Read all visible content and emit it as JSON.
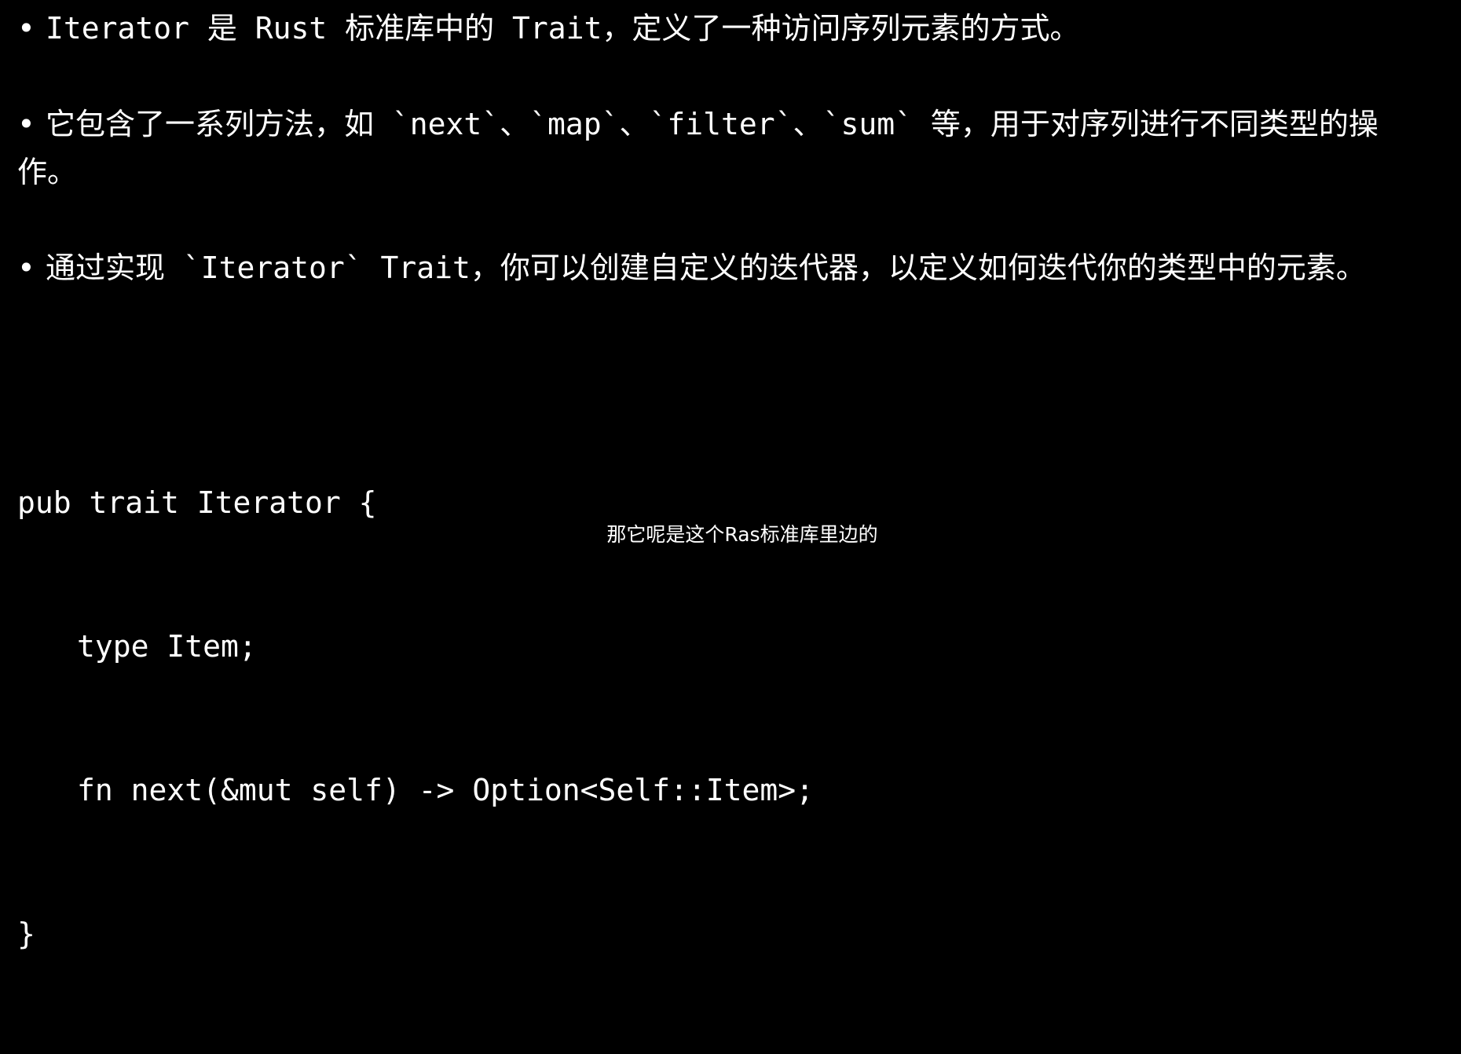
{
  "slide": {
    "bullets": [
      {
        "dot": "•",
        "text": "Iterator 是 Rust 标准库中的 Trait，定义了一种访问序列元素的方式。"
      },
      {
        "dot": "•",
        "text": "它包含了一系列方法，如 `next`、`map`、`filter`、`sum` 等，用于对序列进行不同类型的操作。"
      },
      {
        "dot": "•",
        "text": "通过实现 `Iterator` Trait，你可以创建自定义的迭代器，以定义如何迭代你的类型中的元素。"
      }
    ],
    "code": {
      "line1": "pub trait Iterator {",
      "line2": "type Item;",
      "line3": "fn next(&mut self) -> Option<Self::Item>;",
      "line4": "}"
    }
  },
  "subtitle": {
    "text": "那它呢是这个Ras标准库里边的"
  },
  "colors": {
    "background": "#000000",
    "text": "#ffffff"
  }
}
